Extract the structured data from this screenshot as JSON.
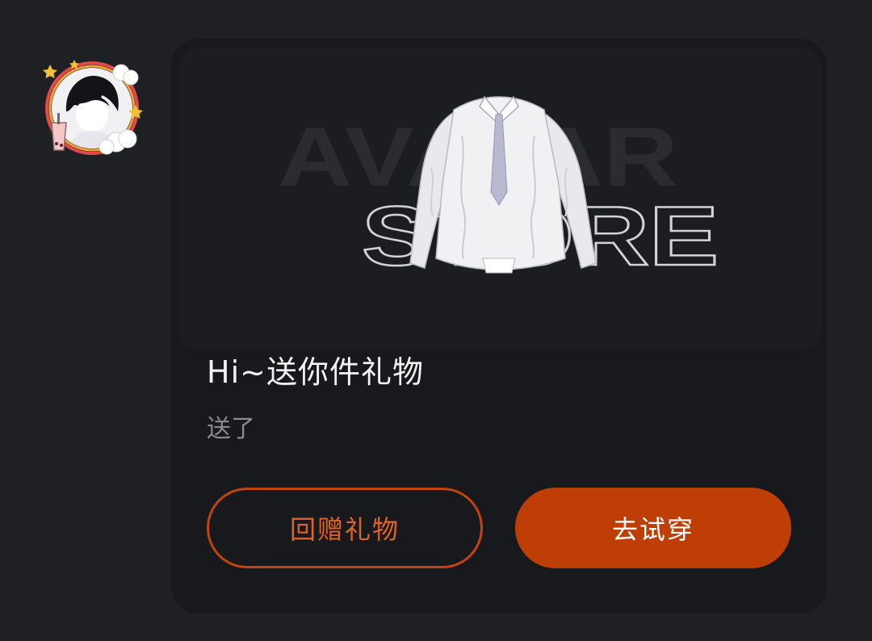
{
  "message": {
    "avatar_icon": "anime-avatar-icon",
    "banner": {
      "word_top": "AVATAR",
      "word_bottom": "STORE",
      "item_icon": "white-cardigan-icon"
    },
    "title": "Hi~送你件礼物",
    "subtitle": "送了",
    "buttons": {
      "return_gift": "回赠礼物",
      "try_on": "去试穿"
    },
    "colors": {
      "accent": "#be3e06",
      "accent_text": "#de6425",
      "card_bg": "#18191c",
      "page_bg": "#1f2023"
    }
  }
}
